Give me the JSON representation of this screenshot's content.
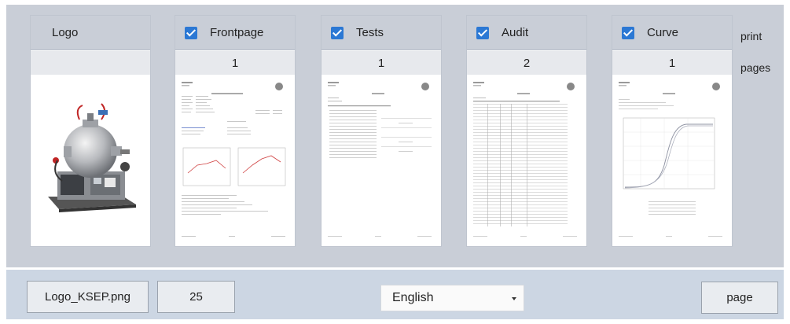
{
  "cards": [
    {
      "name": "logo",
      "label": "Logo",
      "checked": false,
      "pages": ""
    },
    {
      "name": "frontpage",
      "label": "Frontpage",
      "checked": true,
      "pages": "1"
    },
    {
      "name": "tests",
      "label": "Tests",
      "checked": true,
      "pages": "1"
    },
    {
      "name": "audit",
      "label": "Audit",
      "checked": true,
      "pages": "2"
    },
    {
      "name": "curve",
      "label": "Curve",
      "checked": true,
      "pages": "1"
    }
  ],
  "side_labels": {
    "print": "print",
    "pages": "pages"
  },
  "bottom": {
    "logo_file": "Logo_KSEP.png",
    "logo_size": "25",
    "language": "English",
    "page_button": "page"
  },
  "colors": {
    "accent": "#2b78d4",
    "panel": "#c9ced7",
    "bottom_panel": "#ccd6e3"
  }
}
